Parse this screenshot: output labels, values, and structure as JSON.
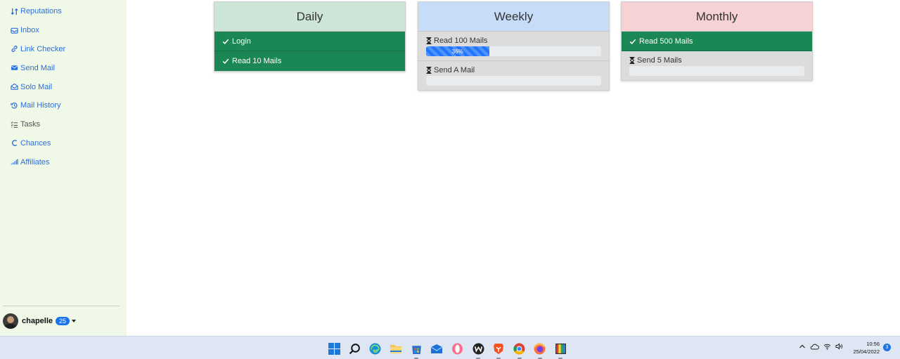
{
  "sidebar": {
    "items": [
      {
        "label": "Reputations",
        "icon": "sort-arrows-icon"
      },
      {
        "label": "Inbox",
        "icon": "inbox-icon"
      },
      {
        "label": "Link Checker",
        "icon": "link-icon"
      },
      {
        "label": "Send Mail",
        "icon": "envelope-icon"
      },
      {
        "label": "Solo Mail",
        "icon": "envelope-open-icon"
      },
      {
        "label": "Mail History",
        "icon": "history-icon"
      },
      {
        "label": "Tasks",
        "icon": "task-list-icon"
      },
      {
        "label": "Chances",
        "icon": "chances-icon"
      },
      {
        "label": "Affiliates",
        "icon": "signal-bars-icon"
      }
    ],
    "user": {
      "name": "chapelle",
      "badge": "25"
    }
  },
  "cards": {
    "daily": {
      "title": "Daily",
      "header_color": "#cde5d7",
      "tasks": [
        {
          "label": "Login",
          "status": "done"
        },
        {
          "label": "Read 10 Mails",
          "status": "done"
        }
      ]
    },
    "weekly": {
      "title": "Weekly",
      "header_color": "#c6dcf8",
      "tasks": [
        {
          "label": "Read 100 Mails",
          "status": "pending",
          "progress": 36,
          "progress_text": "36%"
        },
        {
          "label": "Send A Mail",
          "status": "pending",
          "progress": 0
        }
      ]
    },
    "monthly": {
      "title": "Monthly",
      "header_color": "#f6d2d5",
      "tasks": [
        {
          "label": "Read 500 Mails",
          "status": "done"
        },
        {
          "label": "Send 5 Mails",
          "status": "pending",
          "progress": 0
        }
      ]
    }
  },
  "taskbar": {
    "apps": [
      "windows-start-icon",
      "search-icon",
      "edge-icon",
      "file-explorer-icon",
      "store-icon",
      "mail-icon",
      "opera-icon",
      "wattpad-icon",
      "brave-icon",
      "chrome-icon",
      "firefox-icon",
      "paint-icon"
    ],
    "time": "10:56",
    "date": "25/04/2022",
    "notifications": "3"
  },
  "colors": {
    "done": "#1b8754",
    "link": "#2b6fdb",
    "progress": "#1f75fe",
    "sidebar_bg": "#f0f8e8"
  }
}
